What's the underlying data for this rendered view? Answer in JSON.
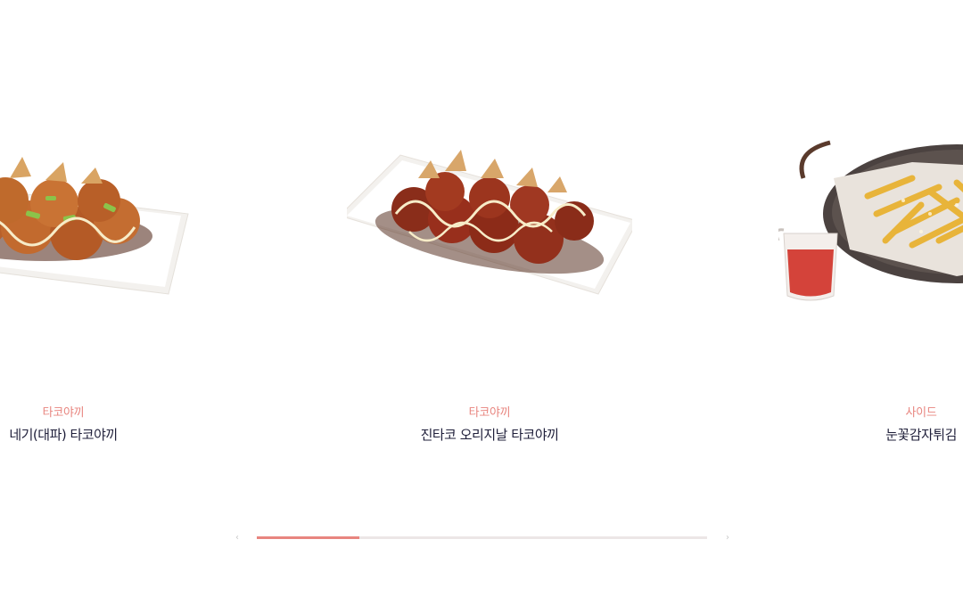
{
  "slides": [
    {
      "category": "타코야끼",
      "name": "네기(대파) 타코야끼",
      "image": "negi-takoyaki-plate"
    },
    {
      "category": "타코야끼",
      "name": "진타코 오리지날 타코야끼",
      "image": "original-takoyaki-plate"
    },
    {
      "category": "사이드",
      "name": "눈꽃감자튀김",
      "image": "snowflake-fries-skillet"
    }
  ],
  "navigation": {
    "prev_icon": "‹",
    "next_icon": "›"
  },
  "progress": {
    "fraction": 0.228
  },
  "colors": {
    "accent": "#e8857f",
    "track": "#ece6e6",
    "text": "#1f1f3a"
  }
}
